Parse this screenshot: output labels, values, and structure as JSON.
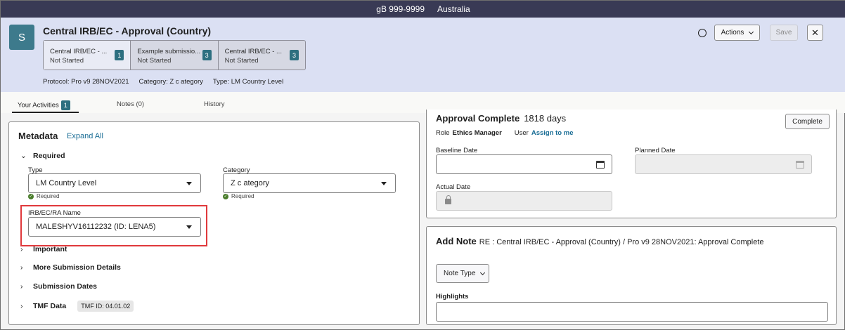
{
  "topbar": {
    "org": "gB 999-9999",
    "region": "Australia"
  },
  "header": {
    "logo_letter": "S",
    "title": "Central IRB/EC - Approval (Country)",
    "steps": [
      {
        "label": "Central IRB/EC - ...",
        "status": "Not Started",
        "count": "1"
      },
      {
        "label": "Example submissio...",
        "status": "Not Started",
        "count": "3"
      },
      {
        "label": "Central IRB/EC - ...",
        "status": "Not Started",
        "count": "3"
      }
    ],
    "protocol": "Protocol: Pro v9 28NOV2021",
    "category": "Category: Z c ategory",
    "type": "Type: LM Country Level",
    "actions_label": "Actions",
    "save_label": "Save",
    "close_label": "✕"
  },
  "tabs": [
    {
      "label": "Your Activities",
      "badge": "1"
    },
    {
      "label": "Notes (0)"
    },
    {
      "label": "History"
    }
  ],
  "metadata": {
    "title": "Metadata",
    "expand_all": "Expand All",
    "required_label": "Required",
    "type_label": "Type",
    "type_value": "LM Country Level",
    "category_label": "Category",
    "category_value": "Z c ategory",
    "required_note": "Required",
    "irb_label": "IRB/EC/RA Name",
    "irb_value": "MALESHYV16112232 (ID:  LENA5)",
    "sections": [
      "Important",
      "More Submission Details",
      "Submission Dates",
      "TMF Data"
    ],
    "tmf_id": "TMF ID: 04.01.02"
  },
  "approval": {
    "title": "Approval Complete",
    "days": "1818 days",
    "role_label": "Role",
    "role_value": "Ethics Manager",
    "user_label": "User",
    "assign_link": "Assign to me",
    "complete_label": "Complete",
    "baseline_label": "Baseline Date",
    "planned_label": "Planned Date",
    "actual_label": "Actual Date"
  },
  "add_note": {
    "title": "Add Note",
    "subtitle": "RE : Central IRB/EC - Approval (Country) / Pro v9 28NOV2021: Approval Complete",
    "note_type_label": "Note Type",
    "highlights_label": "Highlights"
  }
}
